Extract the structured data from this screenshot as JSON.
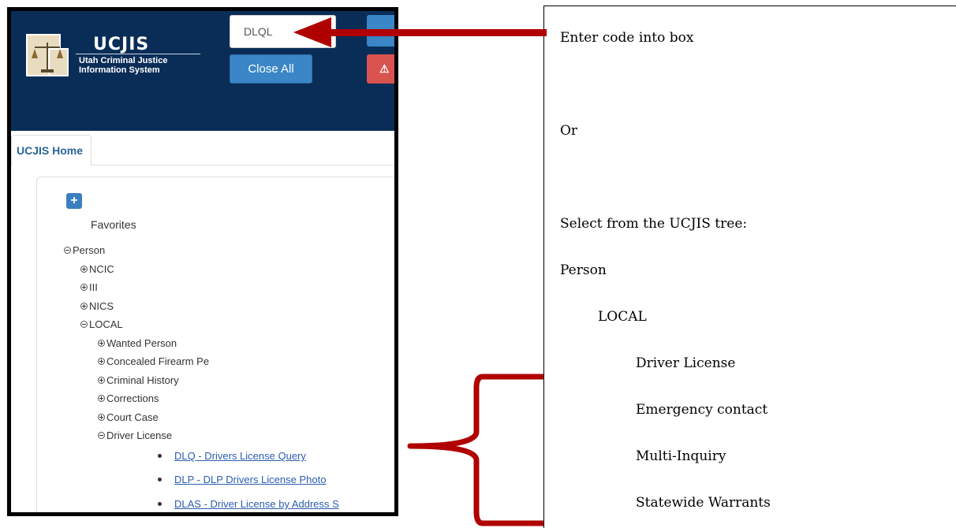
{
  "screenshot": {
    "logo": {
      "title": "UCJIS",
      "subtitle_line1": "Utah Criminal Justice",
      "subtitle_line2": "Information System"
    },
    "code_input": {
      "value": "DLQL"
    },
    "close_all_label": "Close All",
    "red_button_glyph": "⚠",
    "tab_home_label": "UCJIS Home",
    "favorites_label": "Favorites",
    "tree": {
      "person": "Person",
      "ncic": "NCIC",
      "iii": "III",
      "nics": "NICS",
      "local": "LOCAL",
      "wanted_person": "Wanted Person",
      "concealed_firearm": "Concealed Firearm Pe",
      "criminal_history": "Criminal History",
      "corrections": "Corrections",
      "court_case": "Court Case",
      "driver_license": "Driver License",
      "links": [
        "DLQ - Drivers License Query",
        "DLP - DLP Drivers License Photo",
        "DLAS - Driver License by Address S"
      ]
    }
  },
  "instructions": {
    "enter_code": "Enter code into box",
    "or": "Or",
    "select_tree": "Select from the UCJIS tree:",
    "person": "Person",
    "local": "LOCAL",
    "items": [
      "Driver License",
      "Emergency contact",
      "Multi-Inquiry",
      "Statewide Warrants"
    ]
  },
  "colors": {
    "header_bg": "#0a2d58",
    "button_blue": "#3a86c6",
    "button_red": "#d9534f",
    "arrow_red": "#b00000"
  },
  "icons": {
    "logo": "scales-of-justice-icon",
    "add_favorite": "plus-icon",
    "collapse": "circle-minus-icon",
    "expand": "circle-plus-icon",
    "warning": "warning-icon"
  }
}
